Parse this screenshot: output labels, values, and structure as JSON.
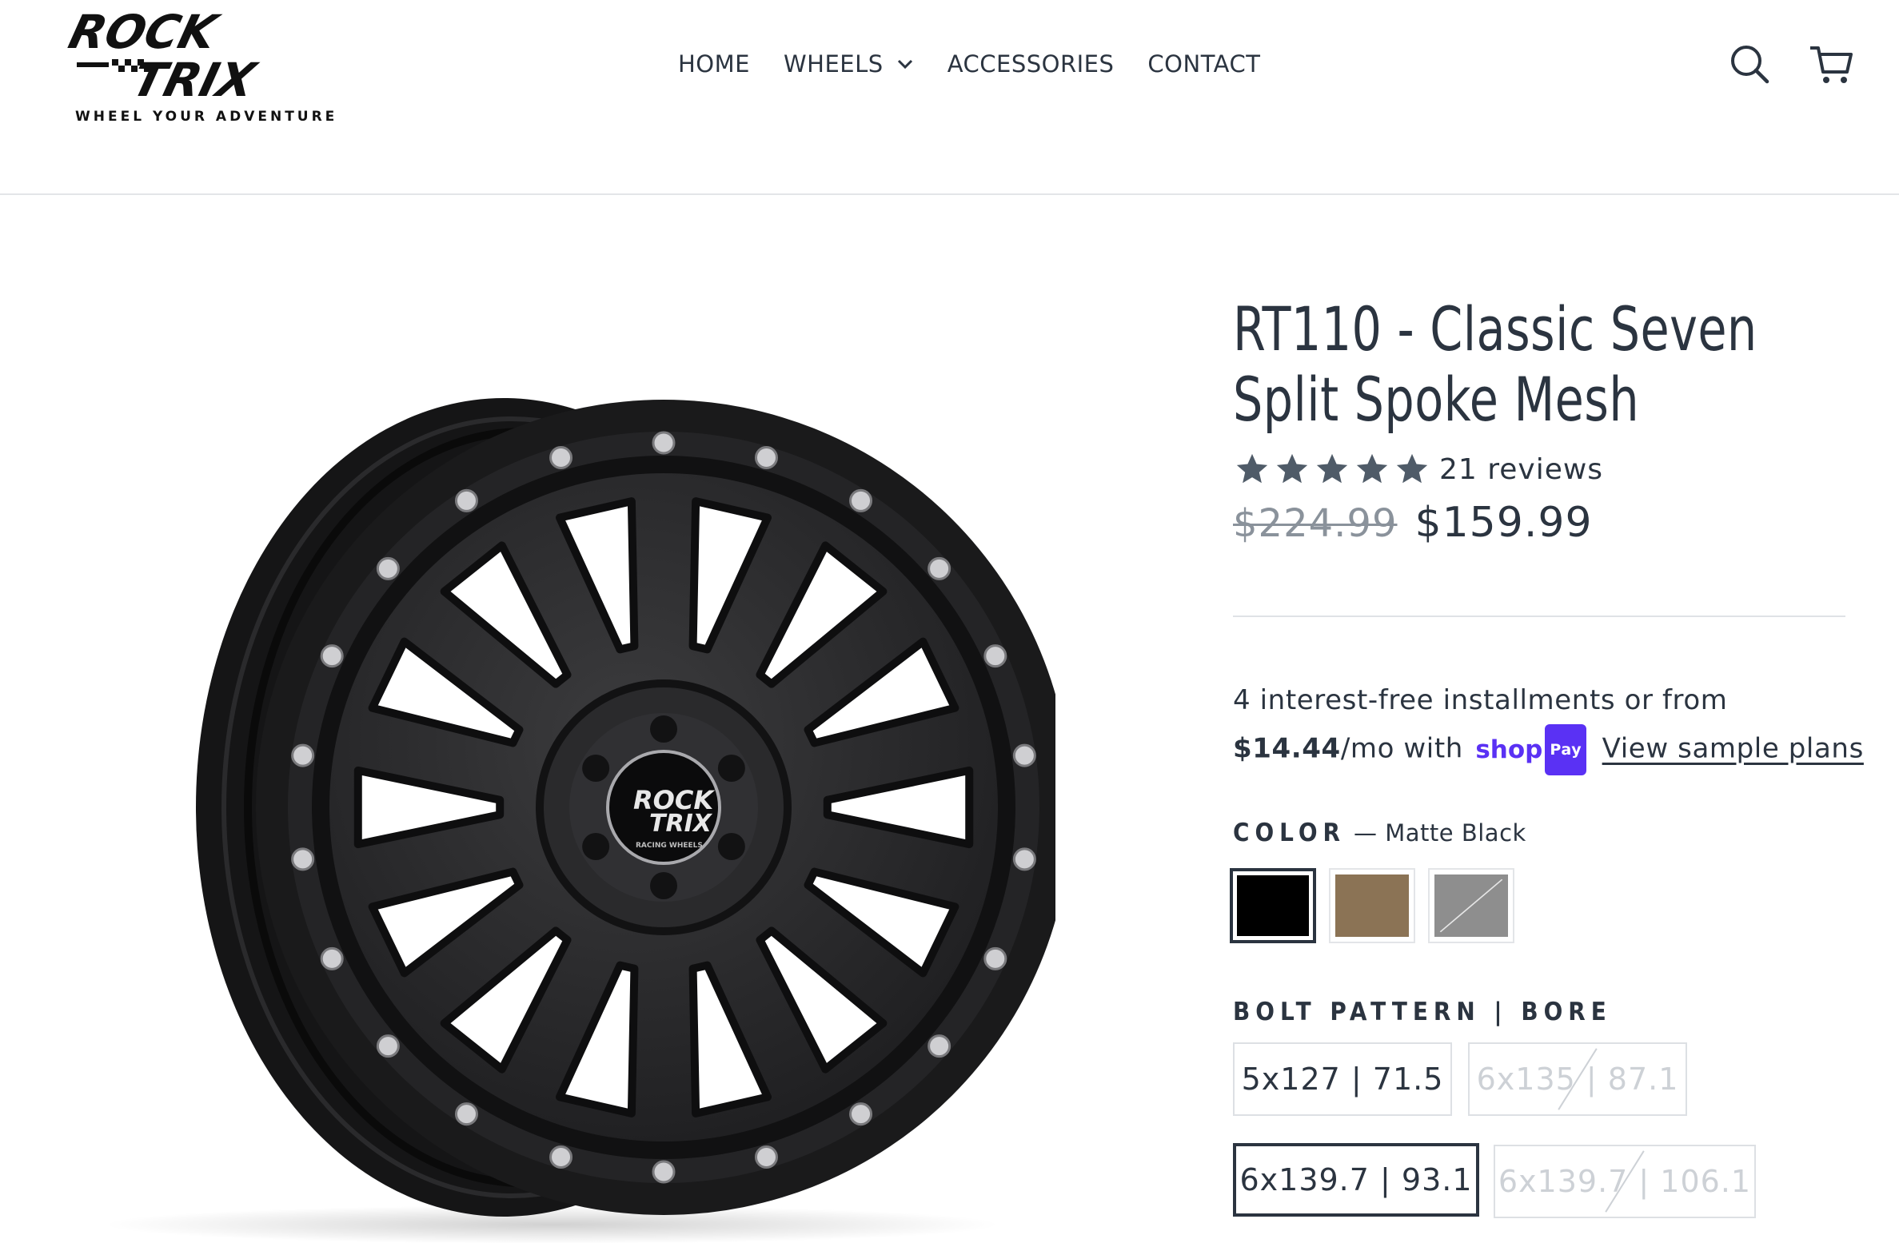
{
  "brand": {
    "logo_line1": "ROCK",
    "logo_line2": "TRIX",
    "tagline": "WHEEL YOUR ADVENTURE"
  },
  "nav": {
    "items": [
      {
        "label": "HOME"
      },
      {
        "label": "WHEELS"
      },
      {
        "label": "ACCESSORIES"
      },
      {
        "label": "CONTACT"
      }
    ]
  },
  "header_icons": [
    "search-icon",
    "cart-icon"
  ],
  "product": {
    "title": "RT110 - Classic Seven Split Spoke Mesh",
    "rating_stars": 5,
    "reviews_label": "21 reviews",
    "price_original": "$224.99",
    "price_sale": "$159.99",
    "installments": {
      "line1": "4 interest-free installments or from",
      "amount": "$14.44",
      "per_month": "/mo with",
      "shop_text": "shop",
      "pay_text": "Pay",
      "link": "View sample plans"
    },
    "image_hub_logo_line1": "ROCK",
    "image_hub_logo_line2": "TRIX",
    "image_hub_logo_sub": "RACING WHEELS"
  },
  "options": {
    "color": {
      "label": "COLOR",
      "selected_text": "— Matte Black",
      "swatches": [
        {
          "name": "Matte Black",
          "color": "#000000",
          "selected": true
        },
        {
          "name": "Bronze",
          "color": "#8b7355",
          "selected": false
        },
        {
          "name": "Gunmetal",
          "color": "#8e8e8e",
          "selected": false,
          "struck": true
        }
      ]
    },
    "bolt": {
      "label": "BOLT PATTERN | BORE",
      "values": [
        {
          "label": "5x127 | 71.5",
          "available": true,
          "selected": false
        },
        {
          "label": "6x135 | 87.1",
          "available": false,
          "selected": false
        },
        {
          "label": "6x139.7 | 93.1",
          "available": true,
          "selected": true
        },
        {
          "label": "6x139.7 | 106.1",
          "available": false,
          "selected": false
        }
      ]
    }
  },
  "colors": {
    "text": "#2b3440",
    "muted": "#8a929b",
    "shoppay": "#5a31f4",
    "star": "#4f5b68"
  }
}
